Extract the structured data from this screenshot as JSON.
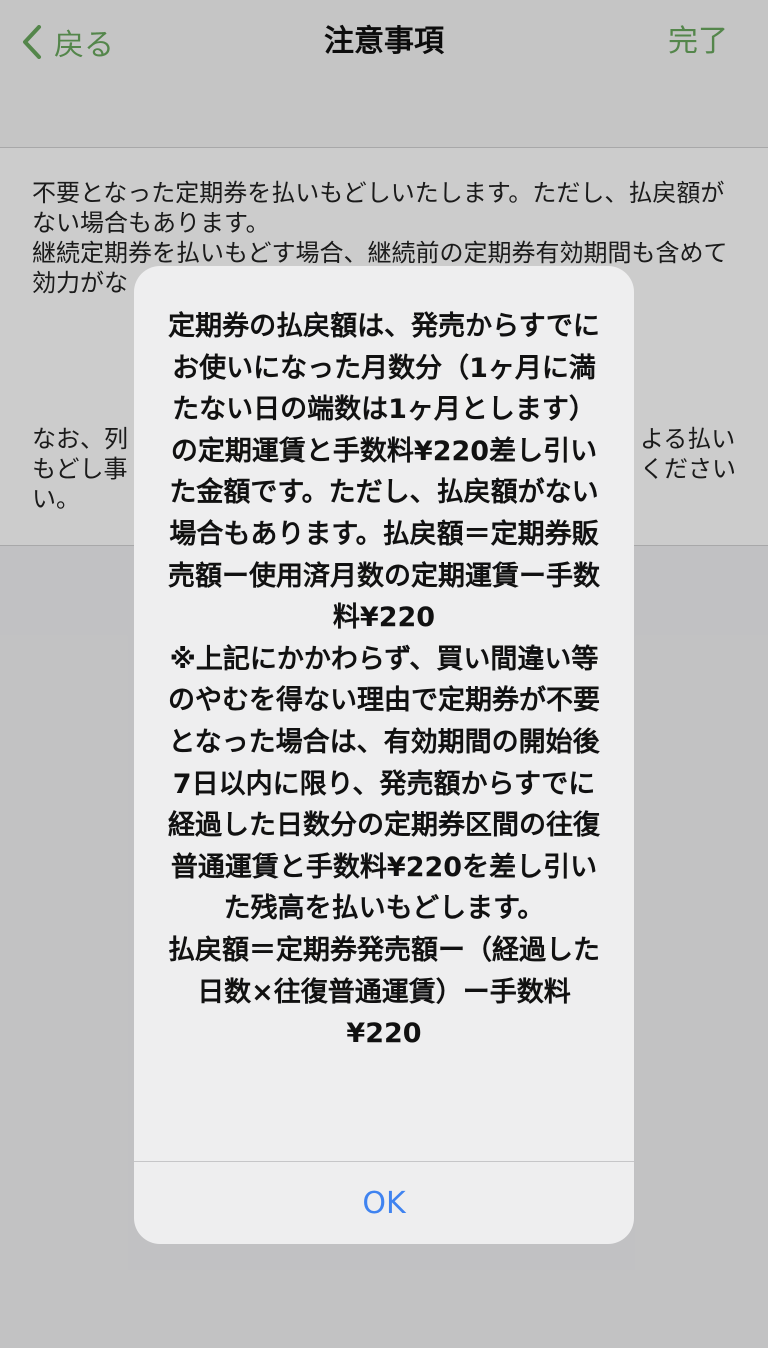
{
  "nav": {
    "back_label": "戻る",
    "title": "注意事項",
    "done_label": "完了"
  },
  "content": {
    "paragraph_1": "不要となった定期券を払いもどしいたします。ただし、払戻額がない場合もあります。",
    "paragraph_2": "継続定期券を払いもどす場合、継続前の定期券有効期間も含めて効力がな",
    "paragraph_3_start": "なお、列",
    "paragraph_3_right_1": "よる払い",
    "paragraph_3_line2": "もどし事",
    "paragraph_3_right_2": "ください",
    "paragraph_3_line3": "い。"
  },
  "alert": {
    "message": "定期券の払戻額は、発売からすでにお使いになった月数分（1ヶ月に満たない日の端数は1ヶ月とします）の定期運賃と手数料¥220差し引いた金額です。ただし、払戻額がない場合もあります。払戻額＝定期券販売額ー使用済月数の定期運賃ー手数料¥220\n※上記にかかわらず、買い間違い等のやむを得ない理由で定期券が不要となった場合は、有効期間の開始後7日以内に限り、発売額からすでに経過した日数分の定期券区間の往復普通運賃と手数料¥220を差し引いた残高を払いもどします。\n払戻額＝定期券発売額ー（経過した日数×往復普通運賃）ー手数料¥220",
    "ok_label": "OK"
  },
  "colors": {
    "accent_green": "#6aa85e",
    "alert_button_blue": "#3f83f0"
  }
}
